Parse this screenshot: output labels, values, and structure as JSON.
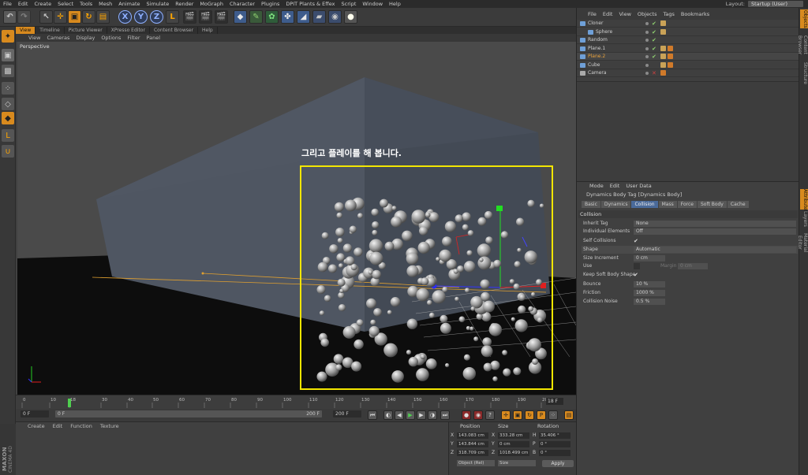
{
  "menubar": {
    "items": [
      "File",
      "Edit",
      "Create",
      "Select",
      "Tools",
      "Mesh",
      "Animate",
      "Simulate",
      "Render",
      "MoGraph",
      "Character",
      "Plugins",
      "DPIT Plants & Effex",
      "Script",
      "Window",
      "Help"
    ],
    "layout_label": "Layout:",
    "layout_value": "Startup (User)"
  },
  "viewport_tabs": [
    "View",
    "Timeline",
    "Picture Viewer",
    "XPresso Editor",
    "Content Browser",
    "Help"
  ],
  "viewport_menu": [
    "View",
    "Cameras",
    "Display",
    "Options",
    "Filter",
    "Panel"
  ],
  "viewport": {
    "label": "Perspective"
  },
  "annotation": {
    "text": "그리고 플레이를 해 봅니다."
  },
  "timeline": {
    "ticks": [
      "0",
      "10",
      "18",
      "30",
      "40",
      "50",
      "60",
      "70",
      "80",
      "90",
      "100",
      "110",
      "120",
      "130",
      "140",
      "150",
      "160",
      "170",
      "180",
      "190",
      "20"
    ],
    "frame_readout": "18 F"
  },
  "transport": {
    "start": "0 F",
    "current": "0 F",
    "end_field": "200 F",
    "end": "200 F"
  },
  "material_menu": [
    "Create",
    "Edit",
    "Function",
    "Texture"
  ],
  "maxon": {
    "logo": "MAXON",
    "sub": "CINEMA 4D"
  },
  "coords": {
    "headers": [
      "Position",
      "Size",
      "Rotation"
    ],
    "rows": [
      {
        "axis": "X",
        "pos": "143.083 cm",
        "size_axis": "X",
        "size": "333.28 cm",
        "rot_axis": "H",
        "rot": "35.406 °"
      },
      {
        "axis": "Y",
        "pos": "143.844 cm",
        "size_axis": "Y",
        "size": "0 cm",
        "rot_axis": "P",
        "rot": "0 °"
      },
      {
        "axis": "Z",
        "pos": "318.709 cm",
        "size_axis": "Z",
        "size": "1018.499 cm",
        "rot_axis": "B",
        "rot": "0 °"
      }
    ],
    "mode": "Object (Rel)",
    "size_mode": "Size",
    "apply": "Apply"
  },
  "object_manager": {
    "menu": [
      "File",
      "Edit",
      "View",
      "Objects",
      "Tags",
      "Bookmarks"
    ],
    "objects": [
      {
        "name": "Cloner",
        "selected": false,
        "indent": 0
      },
      {
        "name": "Sphere",
        "selected": false,
        "indent": 1
      },
      {
        "name": "Random",
        "selected": false,
        "indent": 0
      },
      {
        "name": "Plane.1",
        "selected": false,
        "indent": 0
      },
      {
        "name": "Plane.2",
        "selected": true,
        "indent": 0
      },
      {
        "name": "Cube",
        "selected": false,
        "indent": 0
      },
      {
        "name": "Camera",
        "selected": false,
        "indent": 0
      }
    ]
  },
  "attributes": {
    "menu": [
      "Mode",
      "Edit",
      "User Data"
    ],
    "title": "Dynamics Body Tag [Dynamics Body]",
    "tabs": [
      "Basic",
      "Dynamics",
      "Collision",
      "Mass",
      "Force",
      "Soft Body",
      "Cache"
    ],
    "active_tab": "Collision",
    "section": "Collision",
    "props": [
      {
        "label": "Inherit Tag",
        "value": "None",
        "type": "select"
      },
      {
        "label": "Individual Elements",
        "value": "Off",
        "type": "select"
      },
      {
        "label": "Self Collisions",
        "value": "✔",
        "type": "check"
      },
      {
        "label": "Shape",
        "value": "Automatic",
        "type": "select"
      },
      {
        "label": "Size Increment",
        "value": "0 cm",
        "type": "num"
      },
      {
        "label": "Use",
        "value": "",
        "type": "use"
      },
      {
        "label": "Keep Soft Body Shape",
        "value": "✔",
        "type": "check"
      },
      {
        "label": "Bounce",
        "value": "10 %",
        "type": "num"
      },
      {
        "label": "Friction",
        "value": "1000 %",
        "type": "num"
      },
      {
        "label": "Collision Noise",
        "value": "0.5 %",
        "type": "num"
      }
    ],
    "margin_label": "Margin",
    "margin_value": "0 cm"
  },
  "side_tabs": [
    "Objects",
    "Content Browser",
    "Structure",
    "Attributes",
    "Layers",
    "Material Editor"
  ],
  "colors": {
    "accent": "#d88a1e",
    "highlight": "#f3e600",
    "selected": "#e9a23c"
  }
}
